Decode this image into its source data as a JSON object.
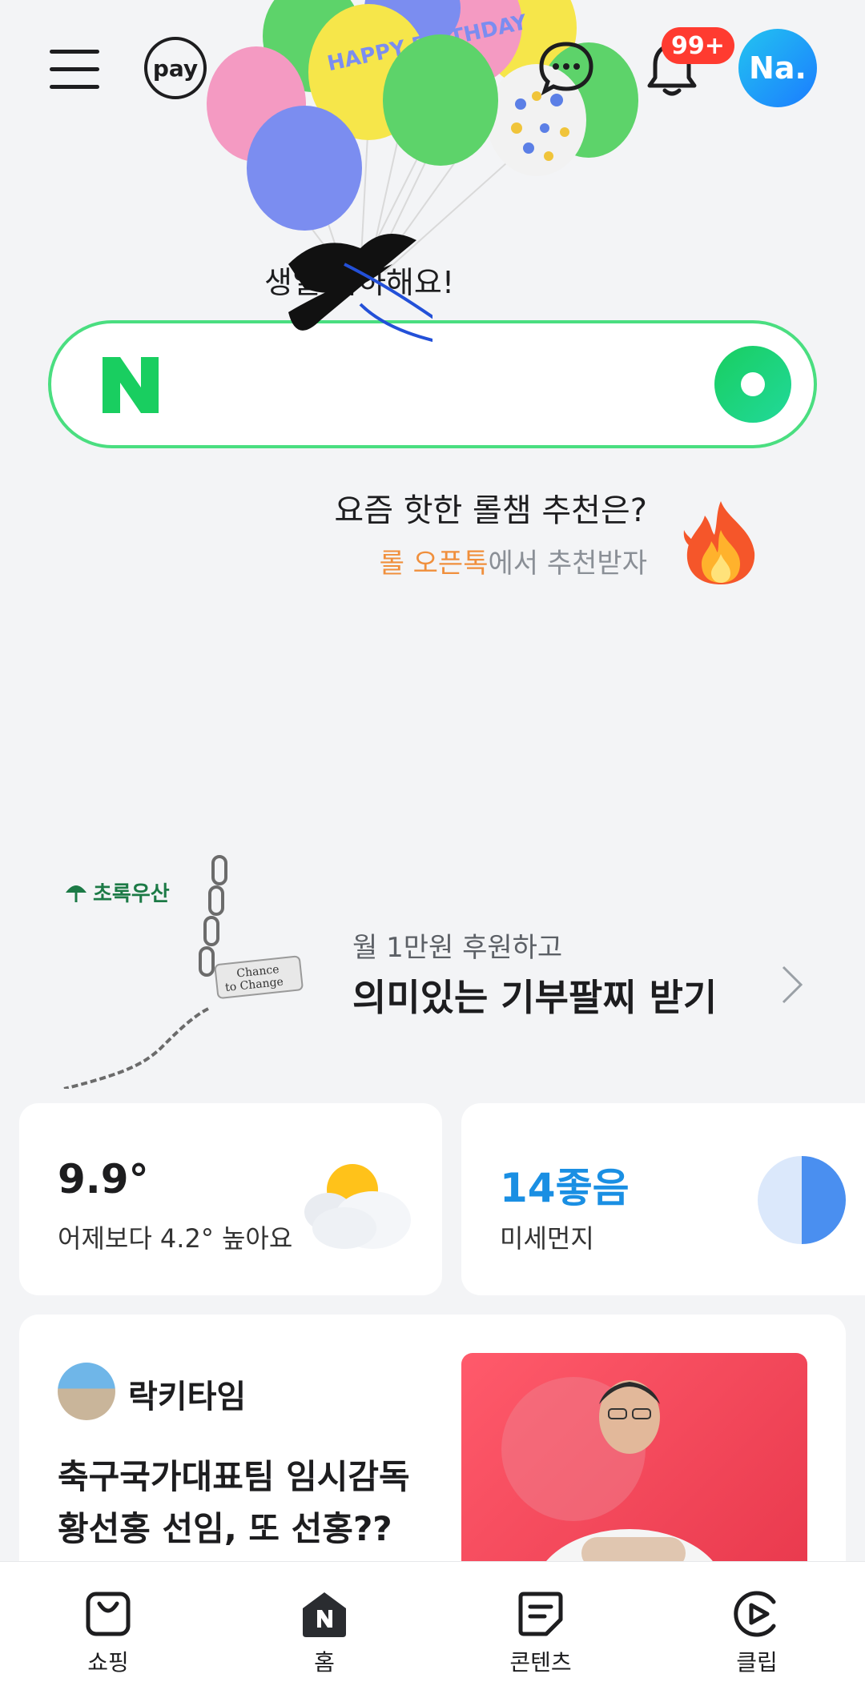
{
  "header": {
    "pay_label": "pay",
    "notification_badge": "99+",
    "avatar_label": "Na."
  },
  "greeting": {
    "text": "생일 축하해요!"
  },
  "search": {
    "logo": "N",
    "placeholder": ""
  },
  "promo": {
    "title": "요즘 핫한 롤챔 추천은?",
    "sub_highlight": "롤 오픈톡",
    "sub_rest": "에서 추천받자"
  },
  "donation": {
    "brand": "초록우산",
    "tag_line1": "Chance",
    "tag_line2": "to Change",
    "subtitle": "월 1만원 후원하고",
    "title": "의미있는 기부팔찌 받기"
  },
  "weather": {
    "temperature": "9.9°",
    "comparison": "어제보다 4.2° 높아요"
  },
  "air": {
    "value": "14좋음",
    "label": "미세먼지",
    "level": 0.5
  },
  "news": {
    "author": "락키타임",
    "title": "축구국가대표팀 임시감독 황선홍 선임, 또 선홍?? ..."
  },
  "balloon_text": "HAPPY BIRTHDAY",
  "nav": {
    "items": [
      {
        "label": "쇼핑",
        "icon": "shopping-bag-icon"
      },
      {
        "label": "홈",
        "icon": "home-n-icon"
      },
      {
        "label": "콘텐츠",
        "icon": "content-icon"
      },
      {
        "label": "클립",
        "icon": "clip-icon"
      }
    ]
  },
  "colors": {
    "accent_green": "#19ce60",
    "badge_red": "#ff3b30",
    "highlight_orange": "#f08f3c",
    "dust_blue": "#1a8fe3"
  }
}
